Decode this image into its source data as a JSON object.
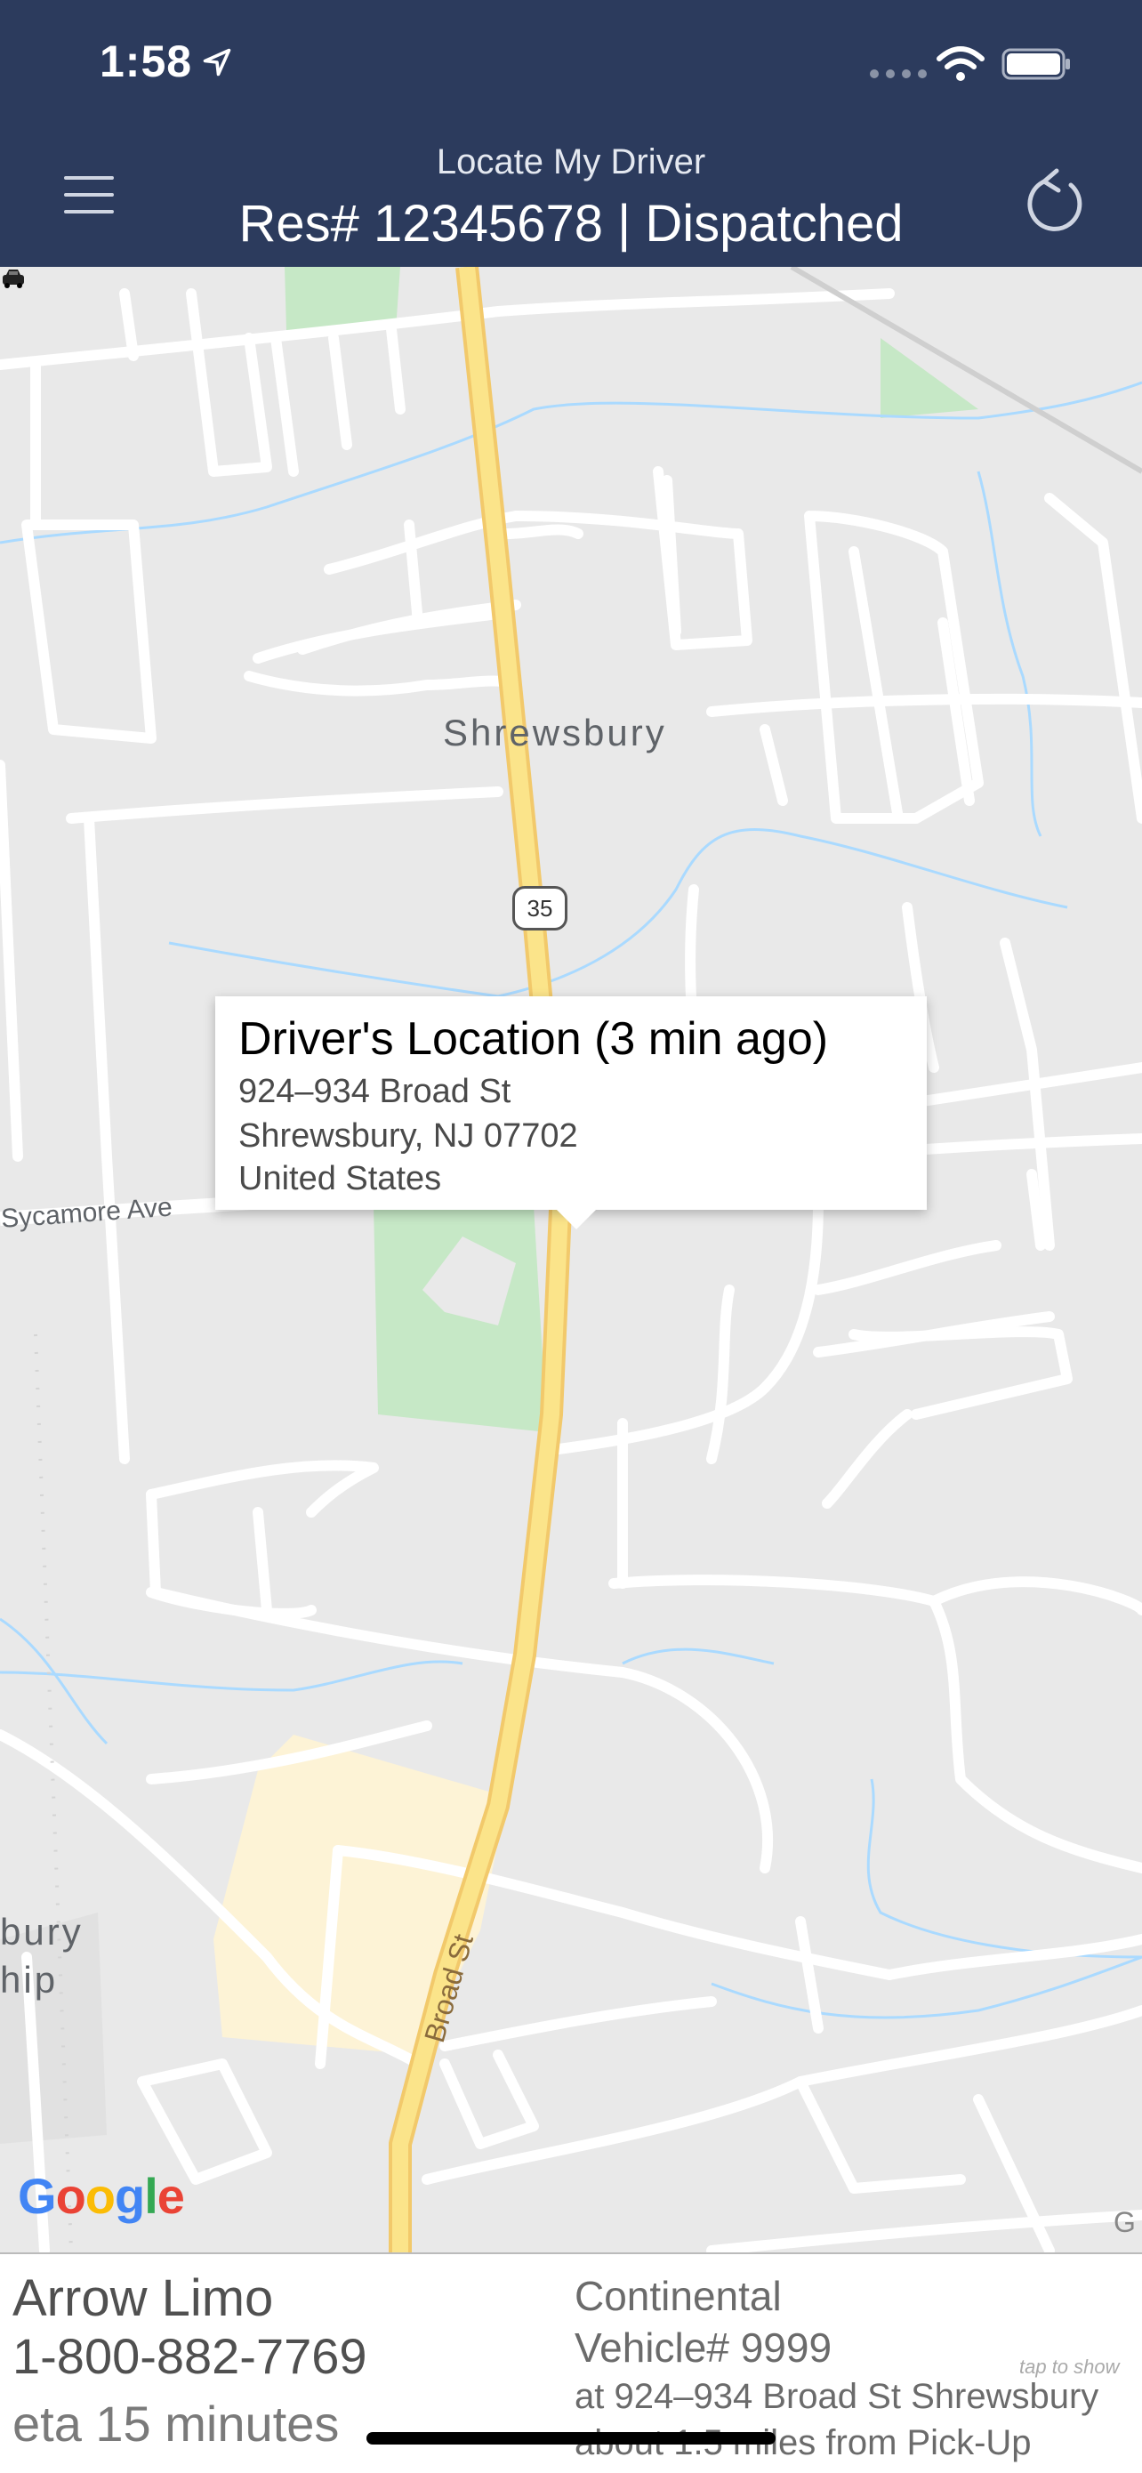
{
  "status_bar": {
    "time": "1:58"
  },
  "header": {
    "subtitle": "Locate My Driver",
    "title": "Res# 12345678 | Dispatched"
  },
  "map": {
    "town_label": "Shrewsbury",
    "partial_label_1": "bury",
    "partial_label_2": "hip",
    "street_sycamore": "Sycamore Ave",
    "street_broad": "Broad St",
    "route_shield": "35",
    "corner_glyph": "G",
    "popup": {
      "title": "Driver's Location (3 min ago)",
      "line1": "924–934 Broad St",
      "line2": "Shrewsbury, NJ  07702",
      "line3": "United States"
    },
    "logo": [
      "G",
      "o",
      "o",
      "g",
      "l",
      "e"
    ]
  },
  "panel": {
    "company": "Arrow Limo",
    "phone": "1-800-882-7769",
    "eta": "eta 15 minutes",
    "vehicle_model": "Continental",
    "vehicle_number": "Vehicle# 9999",
    "vehicle_location": "at 924–934 Broad St Shrewsbury",
    "vehicle_distance": "about 1.5 miles from Pick-Up",
    "tap_hint": "tap to show"
  },
  "colors": {
    "header_bg": "#2c3b5d",
    "map_bg": "#e9e9e9",
    "highway": "#fbe48a",
    "park": "#c6e8c6",
    "water": "#aadaff"
  }
}
